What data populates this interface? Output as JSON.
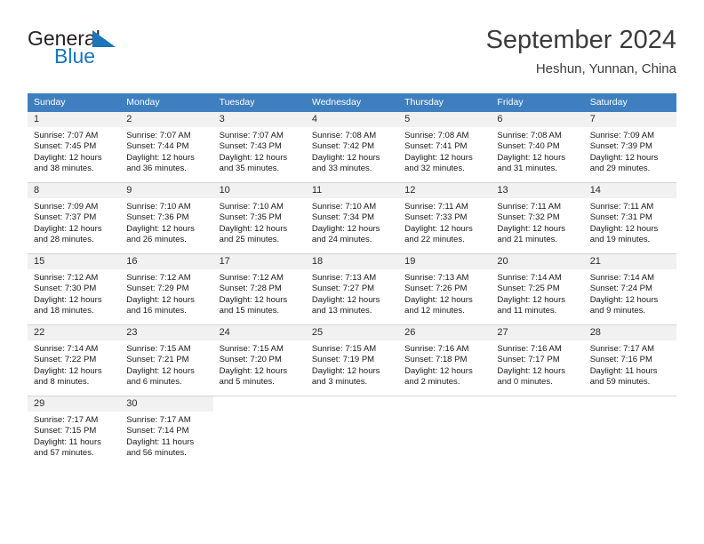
{
  "brand": {
    "name_part1": "General",
    "name_part2": "Blue",
    "triangle_color": "#1b75bb",
    "text_color": "#231f20"
  },
  "header": {
    "title": "September 2024",
    "subtitle": "Heshun, Yunnan, China"
  },
  "theme": {
    "header_background": "#3f7fbf",
    "header_text": "#ffffff",
    "daynum_band": "#f1f1f1",
    "grid_line": "#d4d4d4",
    "cell_background": "#ffffff"
  },
  "weekday_headers": [
    "Sunday",
    "Monday",
    "Tuesday",
    "Wednesday",
    "Thursday",
    "Friday",
    "Saturday"
  ],
  "weeks": [
    [
      {
        "day": "1",
        "sunrise": "Sunrise: 7:07 AM",
        "sunset": "Sunset: 7:45 PM",
        "daylight_line1": "Daylight: 12 hours",
        "daylight_line2": "and 38 minutes."
      },
      {
        "day": "2",
        "sunrise": "Sunrise: 7:07 AM",
        "sunset": "Sunset: 7:44 PM",
        "daylight_line1": "Daylight: 12 hours",
        "daylight_line2": "and 36 minutes."
      },
      {
        "day": "3",
        "sunrise": "Sunrise: 7:07 AM",
        "sunset": "Sunset: 7:43 PM",
        "daylight_line1": "Daylight: 12 hours",
        "daylight_line2": "and 35 minutes."
      },
      {
        "day": "4",
        "sunrise": "Sunrise: 7:08 AM",
        "sunset": "Sunset: 7:42 PM",
        "daylight_line1": "Daylight: 12 hours",
        "daylight_line2": "and 33 minutes."
      },
      {
        "day": "5",
        "sunrise": "Sunrise: 7:08 AM",
        "sunset": "Sunset: 7:41 PM",
        "daylight_line1": "Daylight: 12 hours",
        "daylight_line2": "and 32 minutes."
      },
      {
        "day": "6",
        "sunrise": "Sunrise: 7:08 AM",
        "sunset": "Sunset: 7:40 PM",
        "daylight_line1": "Daylight: 12 hours",
        "daylight_line2": "and 31 minutes."
      },
      {
        "day": "7",
        "sunrise": "Sunrise: 7:09 AM",
        "sunset": "Sunset: 7:39 PM",
        "daylight_line1": "Daylight: 12 hours",
        "daylight_line2": "and 29 minutes."
      }
    ],
    [
      {
        "day": "8",
        "sunrise": "Sunrise: 7:09 AM",
        "sunset": "Sunset: 7:37 PM",
        "daylight_line1": "Daylight: 12 hours",
        "daylight_line2": "and 28 minutes."
      },
      {
        "day": "9",
        "sunrise": "Sunrise: 7:10 AM",
        "sunset": "Sunset: 7:36 PM",
        "daylight_line1": "Daylight: 12 hours",
        "daylight_line2": "and 26 minutes."
      },
      {
        "day": "10",
        "sunrise": "Sunrise: 7:10 AM",
        "sunset": "Sunset: 7:35 PM",
        "daylight_line1": "Daylight: 12 hours",
        "daylight_line2": "and 25 minutes."
      },
      {
        "day": "11",
        "sunrise": "Sunrise: 7:10 AM",
        "sunset": "Sunset: 7:34 PM",
        "daylight_line1": "Daylight: 12 hours",
        "daylight_line2": "and 24 minutes."
      },
      {
        "day": "12",
        "sunrise": "Sunrise: 7:11 AM",
        "sunset": "Sunset: 7:33 PM",
        "daylight_line1": "Daylight: 12 hours",
        "daylight_line2": "and 22 minutes."
      },
      {
        "day": "13",
        "sunrise": "Sunrise: 7:11 AM",
        "sunset": "Sunset: 7:32 PM",
        "daylight_line1": "Daylight: 12 hours",
        "daylight_line2": "and 21 minutes."
      },
      {
        "day": "14",
        "sunrise": "Sunrise: 7:11 AM",
        "sunset": "Sunset: 7:31 PM",
        "daylight_line1": "Daylight: 12 hours",
        "daylight_line2": "and 19 minutes."
      }
    ],
    [
      {
        "day": "15",
        "sunrise": "Sunrise: 7:12 AM",
        "sunset": "Sunset: 7:30 PM",
        "daylight_line1": "Daylight: 12 hours",
        "daylight_line2": "and 18 minutes."
      },
      {
        "day": "16",
        "sunrise": "Sunrise: 7:12 AM",
        "sunset": "Sunset: 7:29 PM",
        "daylight_line1": "Daylight: 12 hours",
        "daylight_line2": "and 16 minutes."
      },
      {
        "day": "17",
        "sunrise": "Sunrise: 7:12 AM",
        "sunset": "Sunset: 7:28 PM",
        "daylight_line1": "Daylight: 12 hours",
        "daylight_line2": "and 15 minutes."
      },
      {
        "day": "18",
        "sunrise": "Sunrise: 7:13 AM",
        "sunset": "Sunset: 7:27 PM",
        "daylight_line1": "Daylight: 12 hours",
        "daylight_line2": "and 13 minutes."
      },
      {
        "day": "19",
        "sunrise": "Sunrise: 7:13 AM",
        "sunset": "Sunset: 7:26 PM",
        "daylight_line1": "Daylight: 12 hours",
        "daylight_line2": "and 12 minutes."
      },
      {
        "day": "20",
        "sunrise": "Sunrise: 7:14 AM",
        "sunset": "Sunset: 7:25 PM",
        "daylight_line1": "Daylight: 12 hours",
        "daylight_line2": "and 11 minutes."
      },
      {
        "day": "21",
        "sunrise": "Sunrise: 7:14 AM",
        "sunset": "Sunset: 7:24 PM",
        "daylight_line1": "Daylight: 12 hours",
        "daylight_line2": "and 9 minutes."
      }
    ],
    [
      {
        "day": "22",
        "sunrise": "Sunrise: 7:14 AM",
        "sunset": "Sunset: 7:22 PM",
        "daylight_line1": "Daylight: 12 hours",
        "daylight_line2": "and 8 minutes."
      },
      {
        "day": "23",
        "sunrise": "Sunrise: 7:15 AM",
        "sunset": "Sunset: 7:21 PM",
        "daylight_line1": "Daylight: 12 hours",
        "daylight_line2": "and 6 minutes."
      },
      {
        "day": "24",
        "sunrise": "Sunrise: 7:15 AM",
        "sunset": "Sunset: 7:20 PM",
        "daylight_line1": "Daylight: 12 hours",
        "daylight_line2": "and 5 minutes."
      },
      {
        "day": "25",
        "sunrise": "Sunrise: 7:15 AM",
        "sunset": "Sunset: 7:19 PM",
        "daylight_line1": "Daylight: 12 hours",
        "daylight_line2": "and 3 minutes."
      },
      {
        "day": "26",
        "sunrise": "Sunrise: 7:16 AM",
        "sunset": "Sunset: 7:18 PM",
        "daylight_line1": "Daylight: 12 hours",
        "daylight_line2": "and 2 minutes."
      },
      {
        "day": "27",
        "sunrise": "Sunrise: 7:16 AM",
        "sunset": "Sunset: 7:17 PM",
        "daylight_line1": "Daylight: 12 hours",
        "daylight_line2": "and 0 minutes."
      },
      {
        "day": "28",
        "sunrise": "Sunrise: 7:17 AM",
        "sunset": "Sunset: 7:16 PM",
        "daylight_line1": "Daylight: 11 hours",
        "daylight_line2": "and 59 minutes."
      }
    ],
    [
      {
        "day": "29",
        "sunrise": "Sunrise: 7:17 AM",
        "sunset": "Sunset: 7:15 PM",
        "daylight_line1": "Daylight: 11 hours",
        "daylight_line2": "and 57 minutes."
      },
      {
        "day": "30",
        "sunrise": "Sunrise: 7:17 AM",
        "sunset": "Sunset: 7:14 PM",
        "daylight_line1": "Daylight: 11 hours",
        "daylight_line2": "and 56 minutes."
      },
      {
        "day": "",
        "sunrise": "",
        "sunset": "",
        "daylight_line1": "",
        "daylight_line2": ""
      },
      {
        "day": "",
        "sunrise": "",
        "sunset": "",
        "daylight_line1": "",
        "daylight_line2": ""
      },
      {
        "day": "",
        "sunrise": "",
        "sunset": "",
        "daylight_line1": "",
        "daylight_line2": ""
      },
      {
        "day": "",
        "sunrise": "",
        "sunset": "",
        "daylight_line1": "",
        "daylight_line2": ""
      },
      {
        "day": "",
        "sunrise": "",
        "sunset": "",
        "daylight_line1": "",
        "daylight_line2": ""
      }
    ]
  ]
}
